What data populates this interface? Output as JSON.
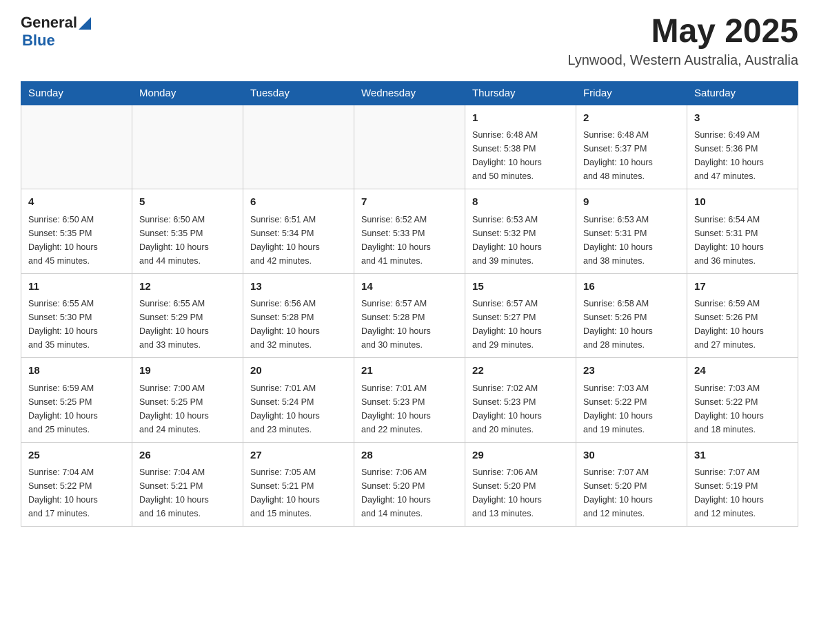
{
  "header": {
    "logo_general": "General",
    "logo_blue": "Blue",
    "month_year": "May 2025",
    "location": "Lynwood, Western Australia, Australia"
  },
  "days_of_week": [
    "Sunday",
    "Monday",
    "Tuesday",
    "Wednesday",
    "Thursday",
    "Friday",
    "Saturday"
  ],
  "weeks": [
    [
      {
        "day": "",
        "info": ""
      },
      {
        "day": "",
        "info": ""
      },
      {
        "day": "",
        "info": ""
      },
      {
        "day": "",
        "info": ""
      },
      {
        "day": "1",
        "info": "Sunrise: 6:48 AM\nSunset: 5:38 PM\nDaylight: 10 hours\nand 50 minutes."
      },
      {
        "day": "2",
        "info": "Sunrise: 6:48 AM\nSunset: 5:37 PM\nDaylight: 10 hours\nand 48 minutes."
      },
      {
        "day": "3",
        "info": "Sunrise: 6:49 AM\nSunset: 5:36 PM\nDaylight: 10 hours\nand 47 minutes."
      }
    ],
    [
      {
        "day": "4",
        "info": "Sunrise: 6:50 AM\nSunset: 5:35 PM\nDaylight: 10 hours\nand 45 minutes."
      },
      {
        "day": "5",
        "info": "Sunrise: 6:50 AM\nSunset: 5:35 PM\nDaylight: 10 hours\nand 44 minutes."
      },
      {
        "day": "6",
        "info": "Sunrise: 6:51 AM\nSunset: 5:34 PM\nDaylight: 10 hours\nand 42 minutes."
      },
      {
        "day": "7",
        "info": "Sunrise: 6:52 AM\nSunset: 5:33 PM\nDaylight: 10 hours\nand 41 minutes."
      },
      {
        "day": "8",
        "info": "Sunrise: 6:53 AM\nSunset: 5:32 PM\nDaylight: 10 hours\nand 39 minutes."
      },
      {
        "day": "9",
        "info": "Sunrise: 6:53 AM\nSunset: 5:31 PM\nDaylight: 10 hours\nand 38 minutes."
      },
      {
        "day": "10",
        "info": "Sunrise: 6:54 AM\nSunset: 5:31 PM\nDaylight: 10 hours\nand 36 minutes."
      }
    ],
    [
      {
        "day": "11",
        "info": "Sunrise: 6:55 AM\nSunset: 5:30 PM\nDaylight: 10 hours\nand 35 minutes."
      },
      {
        "day": "12",
        "info": "Sunrise: 6:55 AM\nSunset: 5:29 PM\nDaylight: 10 hours\nand 33 minutes."
      },
      {
        "day": "13",
        "info": "Sunrise: 6:56 AM\nSunset: 5:28 PM\nDaylight: 10 hours\nand 32 minutes."
      },
      {
        "day": "14",
        "info": "Sunrise: 6:57 AM\nSunset: 5:28 PM\nDaylight: 10 hours\nand 30 minutes."
      },
      {
        "day": "15",
        "info": "Sunrise: 6:57 AM\nSunset: 5:27 PM\nDaylight: 10 hours\nand 29 minutes."
      },
      {
        "day": "16",
        "info": "Sunrise: 6:58 AM\nSunset: 5:26 PM\nDaylight: 10 hours\nand 28 minutes."
      },
      {
        "day": "17",
        "info": "Sunrise: 6:59 AM\nSunset: 5:26 PM\nDaylight: 10 hours\nand 27 minutes."
      }
    ],
    [
      {
        "day": "18",
        "info": "Sunrise: 6:59 AM\nSunset: 5:25 PM\nDaylight: 10 hours\nand 25 minutes."
      },
      {
        "day": "19",
        "info": "Sunrise: 7:00 AM\nSunset: 5:25 PM\nDaylight: 10 hours\nand 24 minutes."
      },
      {
        "day": "20",
        "info": "Sunrise: 7:01 AM\nSunset: 5:24 PM\nDaylight: 10 hours\nand 23 minutes."
      },
      {
        "day": "21",
        "info": "Sunrise: 7:01 AM\nSunset: 5:23 PM\nDaylight: 10 hours\nand 22 minutes."
      },
      {
        "day": "22",
        "info": "Sunrise: 7:02 AM\nSunset: 5:23 PM\nDaylight: 10 hours\nand 20 minutes."
      },
      {
        "day": "23",
        "info": "Sunrise: 7:03 AM\nSunset: 5:22 PM\nDaylight: 10 hours\nand 19 minutes."
      },
      {
        "day": "24",
        "info": "Sunrise: 7:03 AM\nSunset: 5:22 PM\nDaylight: 10 hours\nand 18 minutes."
      }
    ],
    [
      {
        "day": "25",
        "info": "Sunrise: 7:04 AM\nSunset: 5:22 PM\nDaylight: 10 hours\nand 17 minutes."
      },
      {
        "day": "26",
        "info": "Sunrise: 7:04 AM\nSunset: 5:21 PM\nDaylight: 10 hours\nand 16 minutes."
      },
      {
        "day": "27",
        "info": "Sunrise: 7:05 AM\nSunset: 5:21 PM\nDaylight: 10 hours\nand 15 minutes."
      },
      {
        "day": "28",
        "info": "Sunrise: 7:06 AM\nSunset: 5:20 PM\nDaylight: 10 hours\nand 14 minutes."
      },
      {
        "day": "29",
        "info": "Sunrise: 7:06 AM\nSunset: 5:20 PM\nDaylight: 10 hours\nand 13 minutes."
      },
      {
        "day": "30",
        "info": "Sunrise: 7:07 AM\nSunset: 5:20 PM\nDaylight: 10 hours\nand 12 minutes."
      },
      {
        "day": "31",
        "info": "Sunrise: 7:07 AM\nSunset: 5:19 PM\nDaylight: 10 hours\nand 12 minutes."
      }
    ]
  ]
}
